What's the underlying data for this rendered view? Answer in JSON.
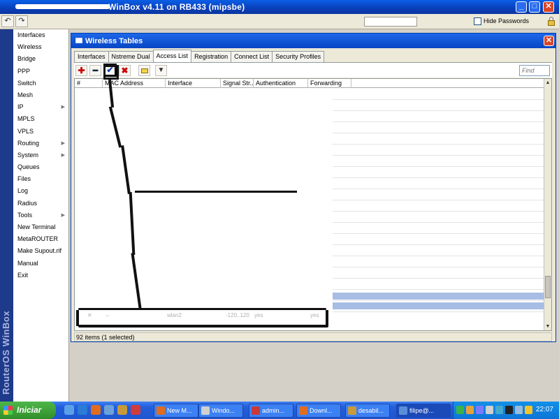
{
  "app": {
    "title": "WinBox v4.11 on RB433 (mipsbe)",
    "brand": "RouterOS WinBox"
  },
  "toolbar": {
    "undo": "↶",
    "redo": "↷",
    "hide_passwords": "Hide Passwords"
  },
  "sidebar": {
    "items": [
      {
        "label": "Interfaces",
        "submenu": false
      },
      {
        "label": "Wireless",
        "submenu": false
      },
      {
        "label": "Bridge",
        "submenu": false
      },
      {
        "label": "PPP",
        "submenu": false
      },
      {
        "label": "Switch",
        "submenu": false
      },
      {
        "label": "Mesh",
        "submenu": false
      },
      {
        "label": "IP",
        "submenu": true
      },
      {
        "label": "MPLS",
        "submenu": false
      },
      {
        "label": "VPLS",
        "submenu": false
      },
      {
        "label": "Routing",
        "submenu": true
      },
      {
        "label": "System",
        "submenu": true
      },
      {
        "label": "Queues",
        "submenu": false
      },
      {
        "label": "Files",
        "submenu": false
      },
      {
        "label": "Log",
        "submenu": false
      },
      {
        "label": "Radius",
        "submenu": false
      },
      {
        "label": "Tools",
        "submenu": true
      },
      {
        "label": "New Terminal",
        "submenu": false
      },
      {
        "label": "MetaROUTER",
        "submenu": false
      },
      {
        "label": "Make Supout.rif",
        "submenu": false
      },
      {
        "label": "Manual",
        "submenu": false
      },
      {
        "label": "Exit",
        "submenu": false
      }
    ]
  },
  "window": {
    "title": "Wireless Tables",
    "tabs": [
      "Interfaces",
      "Nstreme Dual",
      "Access List",
      "Registration",
      "Connect List",
      "Security Profiles"
    ],
    "active_tab": "Access List",
    "find_placeholder": "Find",
    "columns": [
      "#",
      "MAC Address",
      "Interface",
      "Signal Str...",
      "Authentication",
      "Forwarding"
    ],
    "selected_row": {
      "interface": "wlan2",
      "signal": "-120..120",
      "authentication": "yes",
      "forwarding": "yes"
    },
    "status": "92 items (1 selected)"
  },
  "taskbar": {
    "start": "Iniciar",
    "tasks": [
      "New M...",
      "Windo...",
      "admin...",
      "Downl...",
      "desabil...",
      "filipe@..."
    ],
    "clock": "22:07"
  }
}
